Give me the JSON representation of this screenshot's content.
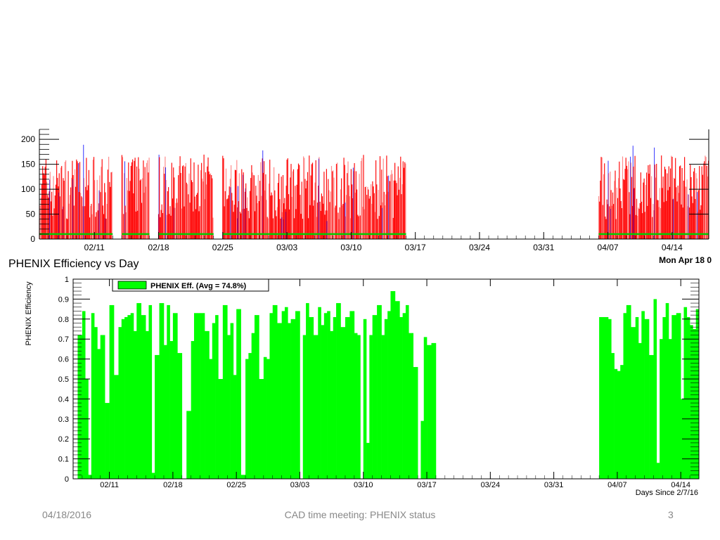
{
  "colors": {
    "top_fill": "#ff0000",
    "top_blue": "#0000ff",
    "top_green": "#00cc00",
    "eff_fill": "#00ff00"
  },
  "footer": {
    "date": "04/18/2016",
    "title": "CAD time meeting: PHENIX status",
    "page": "3"
  },
  "chart_data": [
    {
      "type": "bar",
      "title": "",
      "x_type": "date",
      "x_range": [
        "2016-02-05",
        "2016-04-18"
      ],
      "ylim": [
        0,
        220
      ],
      "yticks": [
        0,
        50,
        100,
        150,
        200
      ],
      "xticks": [
        "02/11",
        "02/18",
        "02/25",
        "03/03",
        "03/10",
        "03/17",
        "03/24",
        "03/31",
        "04/07",
        "04/14"
      ],
      "series": [
        {
          "color": "red",
          "note": "per-fill rate (red bars)"
        },
        {
          "color": "blue"
        },
        {
          "color": "green"
        }
      ],
      "active_ranges": [
        [
          "2016-02-05",
          "2016-02-13"
        ],
        [
          "2016-02-14",
          "2016-02-17"
        ],
        [
          "2016-02-18",
          "2016-02-24"
        ],
        [
          "2016-02-25",
          "2016-03-03"
        ],
        [
          "2016-03-03",
          "2016-03-10"
        ],
        [
          "2016-03-10",
          "2016-03-16"
        ],
        [
          "2016-04-06",
          "2016-04-18"
        ]
      ],
      "green_level": 10
    },
    {
      "type": "bar",
      "title": "PHENIX Efficiency vs Day",
      "timestamp": "Mon Apr 18 0",
      "xlabel": "Days Since 2/7/16",
      "ylabel": "PHENIX Efficiency",
      "ylim": [
        0,
        1
      ],
      "yticks": [
        "0",
        "0.1",
        "0.2",
        "0.3",
        "0.4",
        "0.5",
        "0.6",
        "0.7",
        "0.8",
        "0.9",
        "1"
      ],
      "xticks": [
        "02/11",
        "02/18",
        "02/25",
        "03/03",
        "03/10",
        "03/17",
        "03/24",
        "03/31",
        "04/07",
        "04/14"
      ],
      "legend": "PHENIX Eff. (Avg =  74.8%)",
      "legend_placement": "top-left",
      "x_range": [
        "2016-02-07",
        "2016-04-16"
      ],
      "values": [
        {
          "x": "2016-02-07",
          "y": 0.0
        },
        {
          "x": "2016-02-07",
          "y": 0.72
        },
        {
          "x": "2016-02-08",
          "y": 0.84
        },
        {
          "x": "2016-02-08",
          "y": 0.5
        },
        {
          "x": "2016-02-08",
          "y": 0.02
        },
        {
          "x": "2016-02-09",
          "y": 0.83
        },
        {
          "x": "2016-02-09",
          "y": 0.76
        },
        {
          "x": "2016-02-09",
          "y": 0.65
        },
        {
          "x": "2016-02-10",
          "y": 0.72
        },
        {
          "x": "2016-02-10",
          "y": 0.38
        },
        {
          "x": "2016-02-11",
          "y": 0.87
        },
        {
          "x": "2016-02-11",
          "y": 0.52
        },
        {
          "x": "2016-02-12",
          "y": 0.76
        },
        {
          "x": "2016-02-12",
          "y": 0.8
        },
        {
          "x": "2016-02-12",
          "y": 0.81
        },
        {
          "x": "2016-02-13",
          "y": 0.82
        },
        {
          "x": "2016-02-13",
          "y": 0.83
        },
        {
          "x": "2016-02-13",
          "y": 0.74
        },
        {
          "x": "2016-02-14",
          "y": 0.88
        },
        {
          "x": "2016-02-14",
          "y": 0.82
        },
        {
          "x": "2016-02-15",
          "y": 0.74
        },
        {
          "x": "2016-02-15",
          "y": 0.87
        },
        {
          "x": "2016-02-15",
          "y": 0.03
        },
        {
          "x": "2016-02-16",
          "y": 0.62
        },
        {
          "x": "2016-02-16",
          "y": 0.88
        },
        {
          "x": "2016-02-17",
          "y": 0.67
        },
        {
          "x": "2016-02-17",
          "y": 0.87
        },
        {
          "x": "2016-02-17",
          "y": 0.69
        },
        {
          "x": "2016-02-18",
          "y": 0.83
        },
        {
          "x": "2016-02-18",
          "y": 0.63
        },
        {
          "x": "2016-02-19",
          "y": 0.0
        },
        {
          "x": "2016-02-19",
          "y": 0.34
        },
        {
          "x": "2016-02-20",
          "y": 0.69
        },
        {
          "x": "2016-02-20",
          "y": 0.83
        },
        {
          "x": "2016-02-20",
          "y": 0.83
        },
        {
          "x": "2016-02-21",
          "y": 0.83
        },
        {
          "x": "2016-02-21",
          "y": 0.74
        },
        {
          "x": "2016-02-22",
          "y": 0.6
        },
        {
          "x": "2016-02-22",
          "y": 0.78
        },
        {
          "x": "2016-02-22",
          "y": 0.82
        },
        {
          "x": "2016-02-23",
          "y": 0.5
        },
        {
          "x": "2016-02-23",
          "y": 0.87
        },
        {
          "x": "2016-02-24",
          "y": 0.72
        },
        {
          "x": "2016-02-24",
          "y": 0.78
        },
        {
          "x": "2016-02-24",
          "y": 0.52
        },
        {
          "x": "2016-02-25",
          "y": 0.85
        },
        {
          "x": "2016-02-25",
          "y": 0.02
        },
        {
          "x": "2016-02-26",
          "y": 0.6
        },
        {
          "x": "2016-02-26",
          "y": 0.63
        },
        {
          "x": "2016-02-26",
          "y": 0.73
        },
        {
          "x": "2016-02-27",
          "y": 0.82
        },
        {
          "x": "2016-02-27",
          "y": 0.5
        },
        {
          "x": "2016-02-28",
          "y": 0.61
        },
        {
          "x": "2016-02-28",
          "y": 0.6
        },
        {
          "x": "2016-02-28",
          "y": 0.83
        },
        {
          "x": "2016-02-29",
          "y": 0.87
        },
        {
          "x": "2016-02-29",
          "y": 0.78
        },
        {
          "x": "2016-03-01",
          "y": 0.84
        },
        {
          "x": "2016-03-01",
          "y": 0.86
        },
        {
          "x": "2016-03-01",
          "y": 0.78
        },
        {
          "x": "2016-03-02",
          "y": 0.8
        },
        {
          "x": "2016-03-02",
          "y": 0.84
        },
        {
          "x": "2016-03-03",
          "y": 0.0
        },
        {
          "x": "2016-03-03",
          "y": 0.72
        },
        {
          "x": "2016-03-03",
          "y": 0.88
        },
        {
          "x": "2016-03-04",
          "y": 0.81
        },
        {
          "x": "2016-03-04",
          "y": 0.72
        },
        {
          "x": "2016-03-05",
          "y": 0.86
        },
        {
          "x": "2016-03-05",
          "y": 0.77
        },
        {
          "x": "2016-03-05",
          "y": 0.83
        },
        {
          "x": "2016-03-06",
          "y": 0.84
        },
        {
          "x": "2016-03-06",
          "y": 0.74
        },
        {
          "x": "2016-03-06",
          "y": 0.81
        },
        {
          "x": "2016-03-07",
          "y": 0.88
        },
        {
          "x": "2016-03-07",
          "y": 0.76
        },
        {
          "x": "2016-03-08",
          "y": 0.81
        },
        {
          "x": "2016-03-08",
          "y": 0.84
        },
        {
          "x": "2016-03-09",
          "y": 0.73
        },
        {
          "x": "2016-03-09",
          "y": 0.72
        },
        {
          "x": "2016-03-09",
          "y": 0.0
        },
        {
          "x": "2016-03-10",
          "y": 0.8
        },
        {
          "x": "2016-03-10",
          "y": 0.18
        },
        {
          "x": "2016-03-10",
          "y": 0.72
        },
        {
          "x": "2016-03-11",
          "y": 0.82
        },
        {
          "x": "2016-03-11",
          "y": 0.87
        },
        {
          "x": "2016-03-12",
          "y": 0.72
        },
        {
          "x": "2016-03-12",
          "y": 0.8
        },
        {
          "x": "2016-03-12",
          "y": 0.84
        },
        {
          "x": "2016-03-13",
          "y": 0.94
        },
        {
          "x": "2016-03-13",
          "y": 0.89
        },
        {
          "x": "2016-03-14",
          "y": 0.81
        },
        {
          "x": "2016-03-14",
          "y": 0.83
        },
        {
          "x": "2016-03-14",
          "y": 0.87
        },
        {
          "x": "2016-03-15",
          "y": 0.73
        },
        {
          "x": "2016-03-15",
          "y": 0.56
        },
        {
          "x": "2016-03-16",
          "y": 0.0
        },
        {
          "x": "2016-03-16",
          "y": 0.29
        },
        {
          "x": "2016-03-16",
          "y": 0.71
        },
        {
          "x": "2016-03-17",
          "y": 0.67
        },
        {
          "x": "2016-03-17",
          "y": 0.68
        },
        {
          "x": "2016-04-05",
          "y": 0.81
        },
        {
          "x": "2016-04-06",
          "y": 0.8
        },
        {
          "x": "2016-04-06",
          "y": 0.63
        },
        {
          "x": "2016-04-06",
          "y": 0.55
        },
        {
          "x": "2016-04-07",
          "y": 0.54
        },
        {
          "x": "2016-04-07",
          "y": 0.57
        },
        {
          "x": "2016-04-07",
          "y": 0.83
        },
        {
          "x": "2016-04-08",
          "y": 0.87
        },
        {
          "x": "2016-04-08",
          "y": 0.76
        },
        {
          "x": "2016-04-09",
          "y": 0.81
        },
        {
          "x": "2016-04-09",
          "y": 0.68
        },
        {
          "x": "2016-04-09",
          "y": 0.84
        },
        {
          "x": "2016-04-10",
          "y": 0.8
        },
        {
          "x": "2016-04-10",
          "y": 0.62
        },
        {
          "x": "2016-04-11",
          "y": 0.9
        },
        {
          "x": "2016-04-11",
          "y": 0.08
        },
        {
          "x": "2016-04-11",
          "y": 0.7
        },
        {
          "x": "2016-04-12",
          "y": 0.81
        },
        {
          "x": "2016-04-12",
          "y": 0.88
        },
        {
          "x": "2016-04-12",
          "y": 0.7
        },
        {
          "x": "2016-04-13",
          "y": 0.82
        },
        {
          "x": "2016-04-13",
          "y": 0.83
        },
        {
          "x": "2016-04-14",
          "y": 0.4
        },
        {
          "x": "2016-04-14",
          "y": 0.86
        },
        {
          "x": "2016-04-14",
          "y": 0.81
        },
        {
          "x": "2016-04-15",
          "y": 0.77
        },
        {
          "x": "2016-04-15",
          "y": 0.75
        },
        {
          "x": "2016-04-15",
          "y": 0.85
        }
      ]
    }
  ]
}
